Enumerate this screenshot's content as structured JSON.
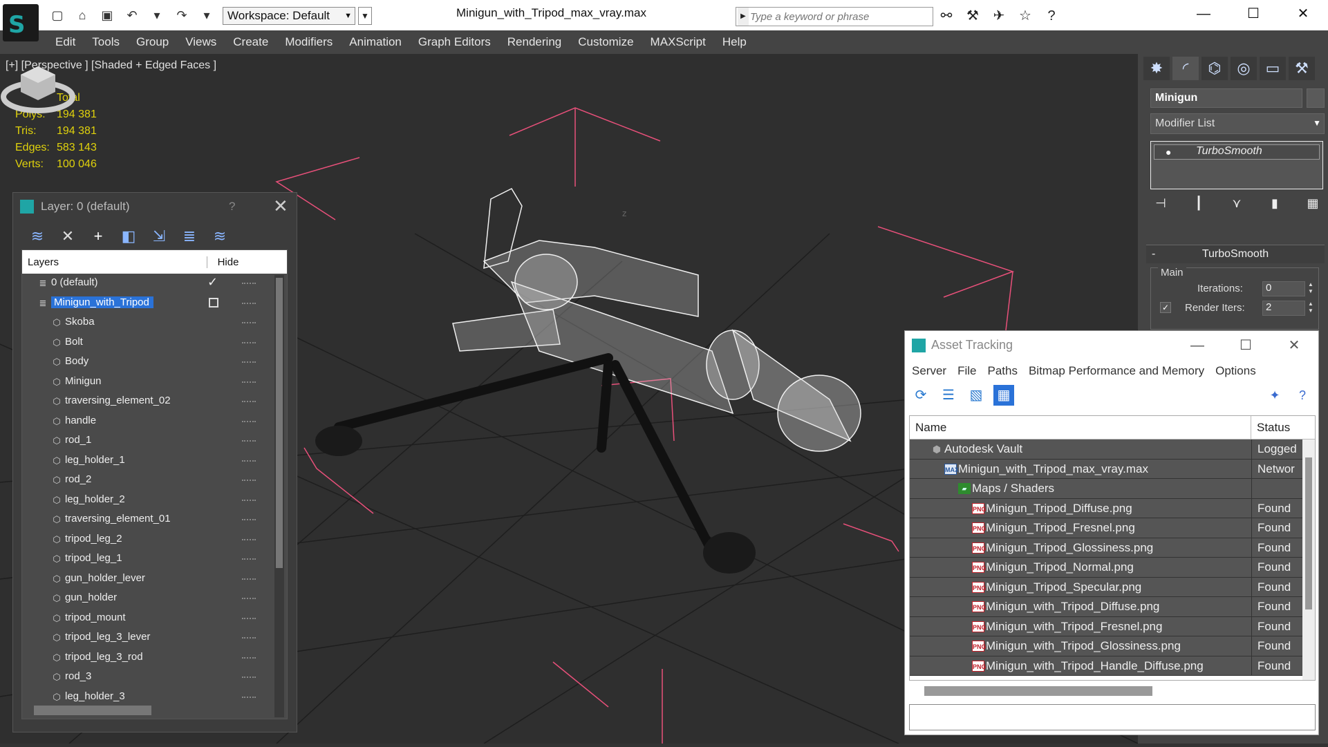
{
  "titlebar": {
    "workspace": "Workspace: Default",
    "doc_title": "Minigun_with_Tripod_max_vray.max",
    "search_placeholder": "Type a keyword or phrase"
  },
  "menu": [
    "Edit",
    "Tools",
    "Group",
    "Views",
    "Create",
    "Modifiers",
    "Animation",
    "Graph Editors",
    "Rendering",
    "Customize",
    "MAXScript",
    "Help"
  ],
  "viewport": {
    "label": "[+] [Perspective ] [Shaded + Edged Faces ]",
    "stats": {
      "header": "Total",
      "rows": [
        {
          "k": "Polys:",
          "v": "194 381"
        },
        {
          "k": "Tris:",
          "v": "194 381"
        },
        {
          "k": "Edges:",
          "v": "583 143"
        },
        {
          "k": "Verts:",
          "v": "100 046"
        }
      ]
    }
  },
  "layer_panel": {
    "title": "Layer: 0 (default)",
    "help": "?",
    "col_layers": "Layers",
    "col_hide": "Hide",
    "rows": [
      {
        "name": "0 (default)",
        "level": 0,
        "type": "layer",
        "mark": "check"
      },
      {
        "name": "Minigun_with_Tripod",
        "level": 0,
        "type": "layer",
        "mark": "box",
        "selected": true
      },
      {
        "name": "Skoba",
        "level": 1,
        "type": "object"
      },
      {
        "name": "Bolt",
        "level": 1,
        "type": "object"
      },
      {
        "name": "Body",
        "level": 1,
        "type": "object"
      },
      {
        "name": "Minigun",
        "level": 1,
        "type": "object"
      },
      {
        "name": "traversing_element_02",
        "level": 1,
        "type": "object"
      },
      {
        "name": "handle",
        "level": 1,
        "type": "object"
      },
      {
        "name": "rod_1",
        "level": 1,
        "type": "object"
      },
      {
        "name": "leg_holder_1",
        "level": 1,
        "type": "object"
      },
      {
        "name": "rod_2",
        "level": 1,
        "type": "object"
      },
      {
        "name": "leg_holder_2",
        "level": 1,
        "type": "object"
      },
      {
        "name": "traversing_element_01",
        "level": 1,
        "type": "object"
      },
      {
        "name": "tripod_leg_2",
        "level": 1,
        "type": "object"
      },
      {
        "name": "tripod_leg_1",
        "level": 1,
        "type": "object"
      },
      {
        "name": "gun_holder_lever",
        "level": 1,
        "type": "object"
      },
      {
        "name": "gun_holder",
        "level": 1,
        "type": "object"
      },
      {
        "name": "tripod_mount",
        "level": 1,
        "type": "object"
      },
      {
        "name": "tripod_leg_3_lever",
        "level": 1,
        "type": "object"
      },
      {
        "name": "tripod_leg_3_rod",
        "level": 1,
        "type": "object"
      },
      {
        "name": "rod_3",
        "level": 1,
        "type": "object"
      },
      {
        "name": "leg_holder_3",
        "level": 1,
        "type": "object"
      }
    ]
  },
  "command_panel": {
    "object_name": "Minigun",
    "modifier_list": "Modifier List",
    "stack_item": "TurboSmooth",
    "rollout_title": "TurboSmooth",
    "group_label": "Main",
    "iterations_label": "Iterations:",
    "iterations_value": "0",
    "render_iters_label": "Render Iters:",
    "render_iters_value": "2"
  },
  "asset_tracking": {
    "title": "Asset Tracking",
    "menu": [
      "Server",
      "File",
      "Paths",
      "Bitmap Performance and Memory",
      "Options"
    ],
    "col_name": "Name",
    "col_status": "Status",
    "rows": [
      {
        "name": "Autodesk Vault",
        "status": "Logged",
        "level": 0,
        "icon": "vault"
      },
      {
        "name": "Minigun_with_Tripod_max_vray.max",
        "status": "Networ",
        "level": 1,
        "icon": "max"
      },
      {
        "name": "Maps / Shaders",
        "status": "",
        "level": 2,
        "icon": "maps"
      },
      {
        "name": "Minigun_Tripod_Diffuse.png",
        "status": "Found",
        "level": 3,
        "icon": "png"
      },
      {
        "name": "Minigun_Tripod_Fresnel.png",
        "status": "Found",
        "level": 3,
        "icon": "png"
      },
      {
        "name": "Minigun_Tripod_Glossiness.png",
        "status": "Found",
        "level": 3,
        "icon": "png"
      },
      {
        "name": "Minigun_Tripod_Normal.png",
        "status": "Found",
        "level": 3,
        "icon": "png"
      },
      {
        "name": "Minigun_Tripod_Specular.png",
        "status": "Found",
        "level": 3,
        "icon": "png"
      },
      {
        "name": "Minigun_with_Tripod_Diffuse.png",
        "status": "Found",
        "level": 3,
        "icon": "png"
      },
      {
        "name": "Minigun_with_Tripod_Fresnel.png",
        "status": "Found",
        "level": 3,
        "icon": "png"
      },
      {
        "name": "Minigun_with_Tripod_Glossiness.png",
        "status": "Found",
        "level": 3,
        "icon": "png"
      },
      {
        "name": "Minigun_with_Tripod_Handle_Diffuse.png",
        "status": "Found",
        "level": 3,
        "icon": "png"
      }
    ]
  },
  "colors": {
    "stats_yellow": "#e0d20c",
    "selection_blue": "#2a72d8",
    "bbox_pink": "#e8507a",
    "app_teal": "#1fa5a5"
  }
}
